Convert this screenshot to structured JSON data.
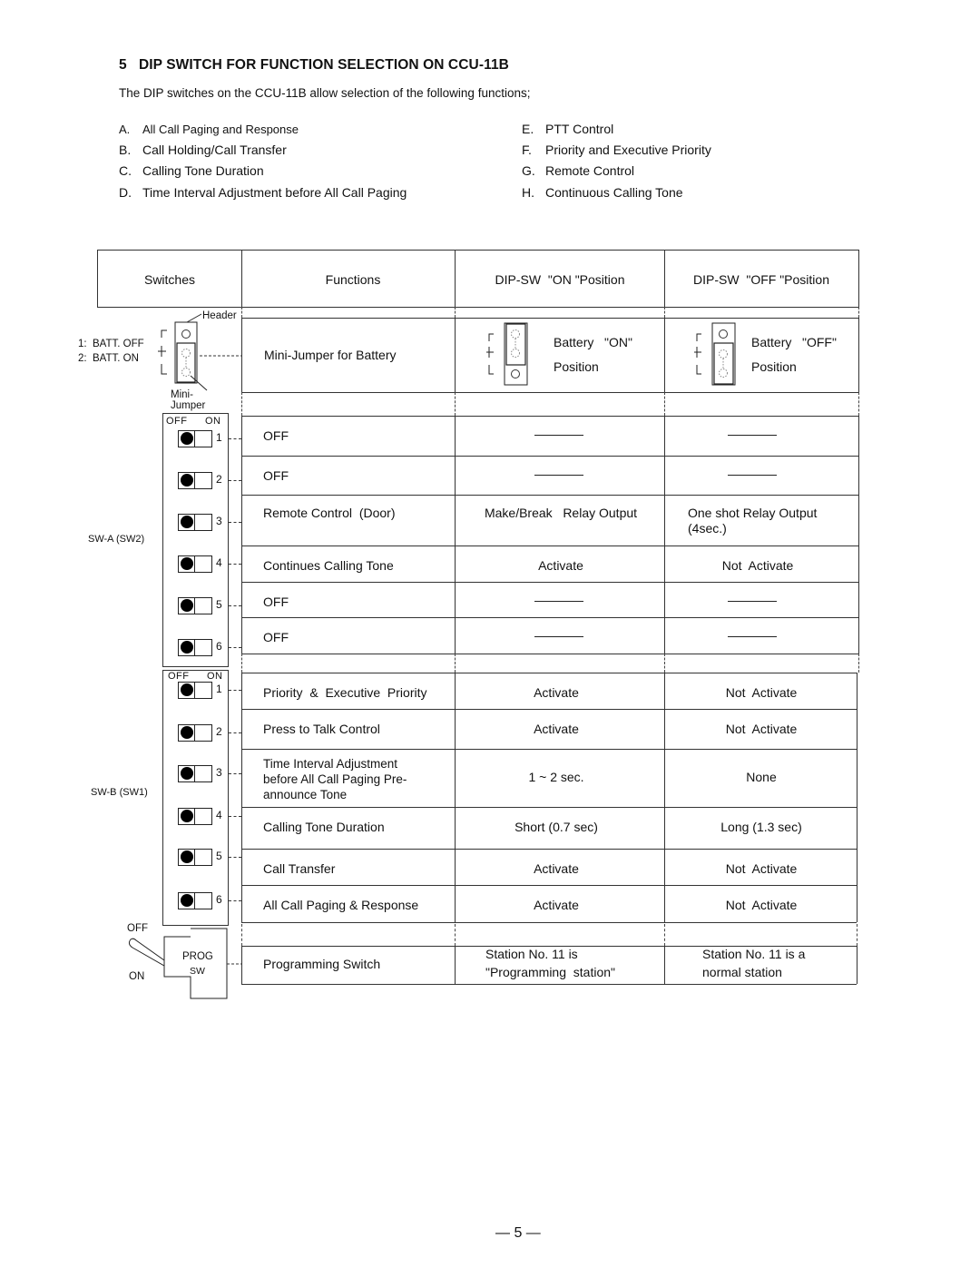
{
  "section": {
    "number": "5",
    "title": "DIP SWITCH FOR FUNCTION SELECTION ON CCU-11B",
    "intro": "The DIP switches on the CCU-11B allow selection of the following functions;"
  },
  "function_list": {
    "left": [
      {
        "letter": "A.",
        "text": "All Call Paging and Response"
      },
      {
        "letter": "B.",
        "text": "Call Holding/Call Transfer"
      },
      {
        "letter": "C.",
        "text": "Calling Tone Duration"
      },
      {
        "letter": "D.",
        "text": "Time Interval Adjustment before All Call Paging"
      }
    ],
    "right": [
      {
        "letter": "E.",
        "text": "PTT Control"
      },
      {
        "letter": "F.",
        "text": "Priority and Executive Priority"
      },
      {
        "letter": "G.",
        "text": "Remote Control"
      },
      {
        "letter": "H.",
        "text": "Continuous Calling Tone"
      }
    ]
  },
  "table": {
    "headers": [
      "Switches",
      "Functions",
      "DIP-SW  \"ON \"Position",
      "DIP-SW  \"OFF \"Position"
    ],
    "jumper": {
      "header_label": "Header",
      "mini_jumper_label": "Mini-Jumper",
      "batt_off": "1:  BATT. OFF",
      "batt_on": "2:  BATT. ON",
      "pin1": "1",
      "pin2": "2",
      "function": "Mini-Jumper for Battery",
      "on_text_1": "Battery   \"ON\"",
      "on_text_2": "Position",
      "off_text_1": "Battery   \"OFF\"",
      "off_text_2": "Position"
    },
    "sw_a": {
      "label": "SW-A (SW2)",
      "off_label": "OFF",
      "on_label": "ON",
      "rows": [
        {
          "num": "1",
          "function": "OFF",
          "on": "———",
          "off": "———",
          "state": "off"
        },
        {
          "num": "2",
          "function": "OFF",
          "on": "———",
          "off": "———",
          "state": "off"
        },
        {
          "num": "3",
          "function": "Remote Control  (Door)",
          "on": "Make/Break   Relay Output",
          "off": "One shot Relay Output (4sec.)",
          "state": "off"
        },
        {
          "num": "4",
          "function": "Continues Calling Tone",
          "on": "Activate",
          "off": "Not  Activate",
          "state": "off"
        },
        {
          "num": "5",
          "function": "OFF",
          "on": "———",
          "off": "———",
          "state": "off"
        },
        {
          "num": "6",
          "function": "OFF",
          "on": "———",
          "off": "———",
          "state": "off"
        }
      ]
    },
    "sw_b": {
      "label": "SW-B (SW1)",
      "off_label": "OFF",
      "on_label": "ON",
      "rows": [
        {
          "num": "1",
          "function": "Priority  &  Executive  Priority",
          "on": "Activate",
          "off": "Not  Activate",
          "state": "off"
        },
        {
          "num": "2",
          "function": "Press to Talk Control",
          "on": "Activate",
          "off": "Not  Activate",
          "state": "off"
        },
        {
          "num": "3",
          "function": "Time  Interval  Adjustment before All Call Paging Pre-announce Tone",
          "function_lines": [
            "Time  Interval  Adjustment",
            "before All Call Paging Pre-",
            "announce Tone"
          ],
          "on": "1 ~ 2 sec.",
          "off": "None",
          "state": "off"
        },
        {
          "num": "4",
          "function": "Calling Tone Duration",
          "on": "Short (0.7 sec)",
          "off": "Long (1.3 sec)",
          "state": "off"
        },
        {
          "num": "5",
          "function": "Call Transfer",
          "on": "Activate",
          "off": "Not  Activate",
          "state": "off"
        },
        {
          "num": "6",
          "function": "All Call Paging & Response",
          "on": "Activate",
          "off": "Not  Activate",
          "state": "off"
        }
      ]
    },
    "prog": {
      "off_label": "OFF",
      "on_label": "ON",
      "sw_label_1": "PROG",
      "sw_label_2": "SW",
      "function": "Programming Switch",
      "on_line_1": "Station No. 11 is",
      "on_line_2": "\"Programming  station\"",
      "off_line_1": "Station No. 11 is a",
      "off_line_2": "normal station"
    }
  },
  "page_number": "— 5 —"
}
